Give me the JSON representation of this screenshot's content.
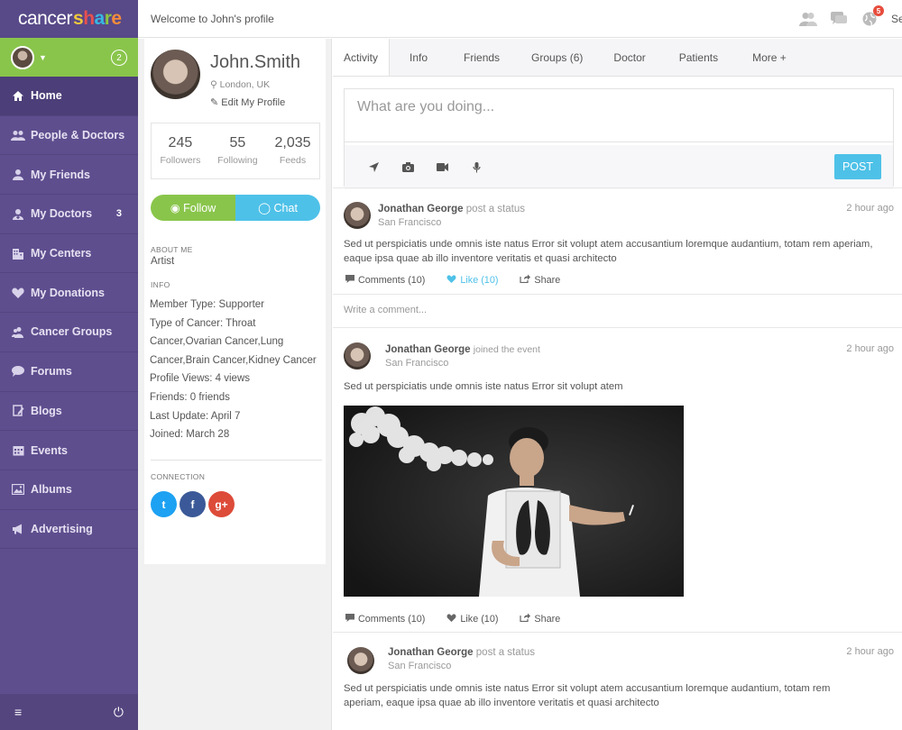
{
  "app": {
    "logo_part1": "cancer",
    "logo_part2_letters": [
      "s",
      "h",
      "a",
      "r",
      "e"
    ]
  },
  "sidebar": {
    "user_badge": "2",
    "items": [
      {
        "label": "Home",
        "icon": "home-icon",
        "count": ""
      },
      {
        "label": "People & Doctors",
        "icon": "people-icon",
        "count": ""
      },
      {
        "label": "My Friends",
        "icon": "user-icon",
        "count": ""
      },
      {
        "label": "My Doctors",
        "icon": "doctor-icon",
        "count": "3"
      },
      {
        "label": "My Centers",
        "icon": "building-icon",
        "count": ""
      },
      {
        "label": "My Donations",
        "icon": "heart-icon",
        "count": ""
      },
      {
        "label": "Cancer Groups",
        "icon": "group-icon",
        "count": ""
      },
      {
        "label": "Forums",
        "icon": "chat-bubble-icon",
        "count": ""
      },
      {
        "label": "Blogs",
        "icon": "blog-icon",
        "count": ""
      },
      {
        "label": "Events",
        "icon": "calendar-icon",
        "count": ""
      },
      {
        "label": "Albums",
        "icon": "image-icon",
        "count": ""
      },
      {
        "label": "Advertising",
        "icon": "megaphone-icon",
        "count": ""
      }
    ]
  },
  "header": {
    "welcome": "Welcome to John's profile",
    "notifications_count": "5",
    "truncated_link": "Se"
  },
  "profile": {
    "name": "John.Smith",
    "location": "London, UK",
    "edit_label": "Edit My Profile",
    "stats": [
      {
        "value": "245",
        "label": "Followers"
      },
      {
        "value": "55",
        "label": "Following"
      },
      {
        "value": "2,035",
        "label": "Feeds"
      }
    ],
    "follow_label": "Follow",
    "chat_label": "Chat",
    "about_heading": "ABOUT ME",
    "about_value": "Artist",
    "info_heading": "INFO",
    "info": [
      "Member Type: Supporter",
      "Type of Cancer: Throat",
      "Cancer,Ovarian Cancer,Lung",
      "Cancer,Brain Cancer,Kidney Cancer",
      "Profile Views: 4 views",
      "Friends: 0 friends",
      "Last Update: April 7",
      "Joined: March 28"
    ],
    "connection_heading": "CONNECTION",
    "socials": [
      {
        "name": "twitter",
        "glyph": "t",
        "color": "#1da1f2"
      },
      {
        "name": "facebook",
        "glyph": "f",
        "color": "#3b5998"
      },
      {
        "name": "google-plus",
        "glyph": "g+",
        "color": "#dd4b39"
      }
    ]
  },
  "tabs": [
    "Activity",
    "Info",
    "Friends",
    "Groups (6)",
    "Doctor",
    "Patients",
    "More +"
  ],
  "composer": {
    "placeholder": "What are you doing...",
    "post_label": "POST"
  },
  "posts": [
    {
      "author": "Jonathan George",
      "action": "post a status",
      "location": "San Francisco",
      "time": "2 hour ago",
      "text": "Sed ut perspiciatis unde omnis iste natus Error sit volupt atem accusantium loremque audantium, totam rem aperiam, eaque ipsa quae ab illo inventore veritatis et quasi architecto",
      "comments_label": "Comments (10)",
      "like_label": "Like (10)",
      "share_label": "Share",
      "comment_placeholder": "Write a comment..."
    },
    {
      "author": "Jonathan George",
      "action": "joined the event",
      "location": "San Francisco",
      "time": "2 hour ago",
      "text": "Sed ut perspiciatis unde omnis iste natus Error sit volupt atem",
      "comments_label": "Comments (10)",
      "like_label": "Like (10)",
      "share_label": "Share"
    },
    {
      "author": "Jonathan George",
      "action": "post a status",
      "location": "San Francisco",
      "time": "2 hour ago",
      "text": "Sed ut perspiciatis unde omnis iste natus Error sit volupt atem accusantium loremque audantium, totam rem aperiam, eaque ipsa quae ab illo inventore veritatis et quasi architecto"
    }
  ]
}
